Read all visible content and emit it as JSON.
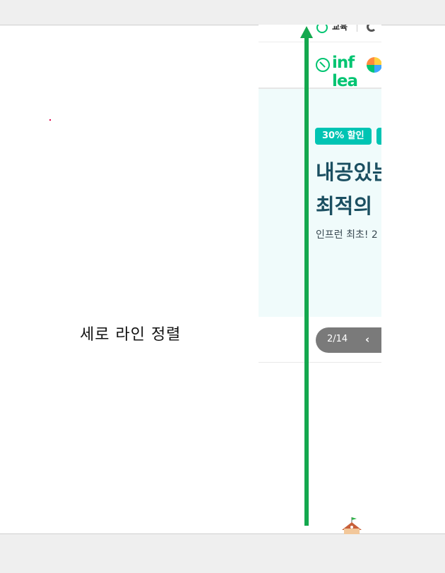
{
  "caption": "세로 라인 정렬",
  "site": {
    "util_menu": {
      "education_label": "교육"
    },
    "logo": {
      "text": "inf lea"
    },
    "banner": {
      "badges": [
        "30% 할인",
        ""
      ],
      "headline_line1": "내공있는",
      "headline_line2": "최적의",
      "subline": "인프런 최초! 2"
    },
    "pager": {
      "count": "2/14",
      "prev_glyph": "‹"
    }
  },
  "colors": {
    "arrow": "#14a84e",
    "brand": "#00c471",
    "badge": "#00c4b3",
    "headline": "#1b4f61",
    "banner_bg": "#f0fbfb"
  }
}
